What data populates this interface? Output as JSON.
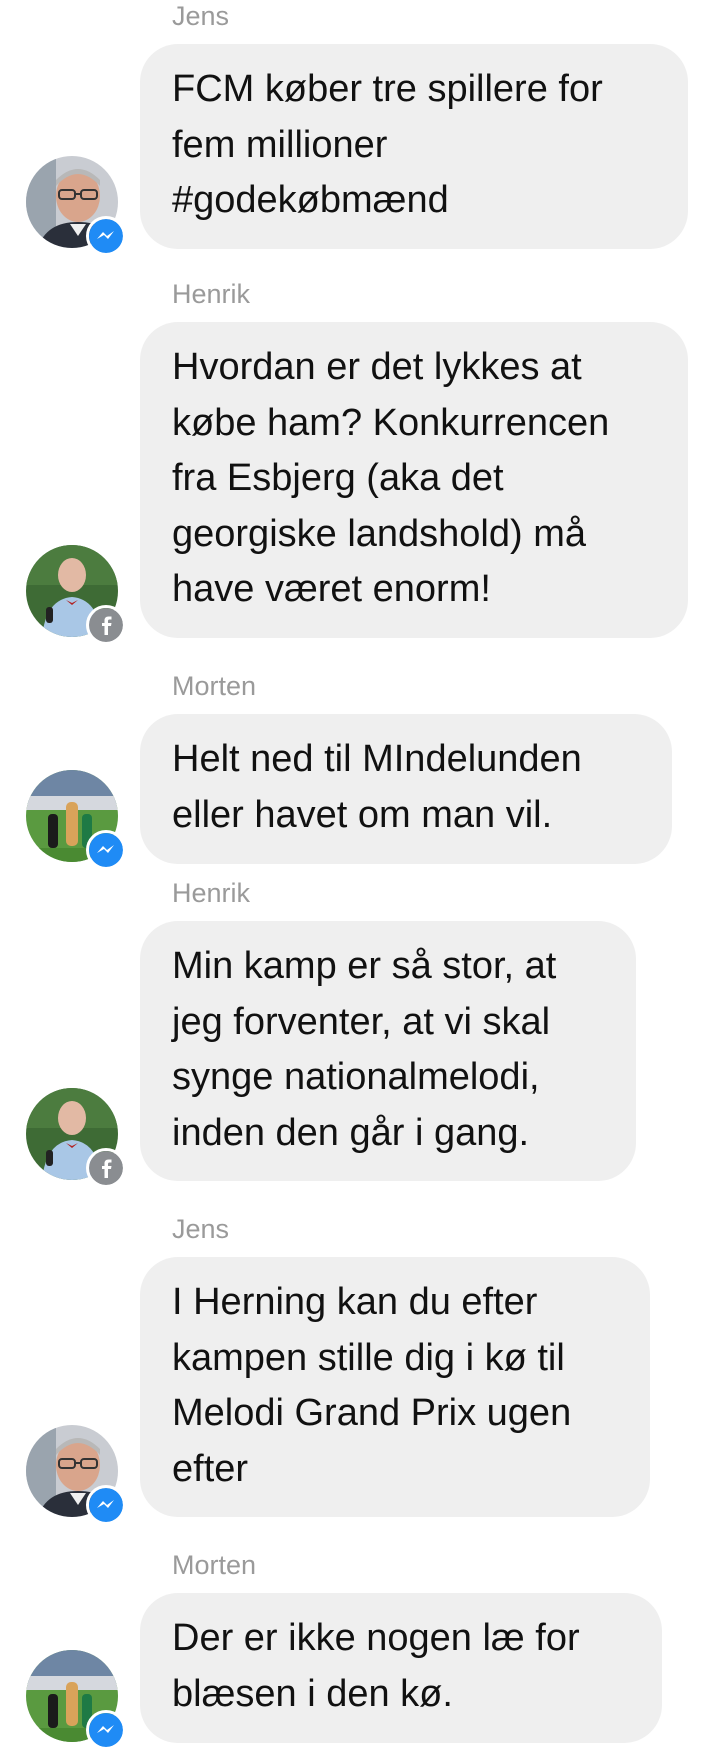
{
  "conversation": {
    "messages": [
      {
        "sender": "Jens",
        "text": "FCM køber tre spillere for\nfem millioner\n#godekøbmænd",
        "avatar": "jens-avatar",
        "badge": "messenger-icon"
      },
      {
        "sender": "Henrik",
        "text": "Hvordan er det lykkes at\nkøbe ham? Konkurrencen\nfra Esbjerg (aka det\ngeorgiske landshold) må\nhave været enorm!",
        "avatar": "henrik-avatar",
        "badge": "facebook-icon"
      },
      {
        "sender": "Morten",
        "text": "Helt ned til MIndelunden\neller havet om man vil.",
        "avatar": "morten-avatar",
        "badge": "messenger-icon"
      },
      {
        "sender": "Henrik",
        "text": "Min kamp er så stor, at\njeg forventer, at vi skal\nsynge nationalmelodi,\ninden den går i gang.",
        "avatar": "henrik-avatar",
        "badge": "facebook-icon"
      },
      {
        "sender": "Jens",
        "text": "I Herning kan du efter\nkampen stille dig i kø til\nMelodi Grand Prix ugen\nefter",
        "avatar": "jens-avatar",
        "badge": "messenger-icon"
      },
      {
        "sender": "Morten",
        "text": "Der er ikke nogen læ for\nblæsen i den kø.",
        "avatar": "morten-avatar",
        "badge": "messenger-icon"
      }
    ]
  },
  "colors": {
    "bubble": "#efefef",
    "sender_name": "#9a9a9a",
    "text": "#111111",
    "messenger_badge": "#1f8bf5",
    "facebook_badge": "#8a8d91"
  }
}
